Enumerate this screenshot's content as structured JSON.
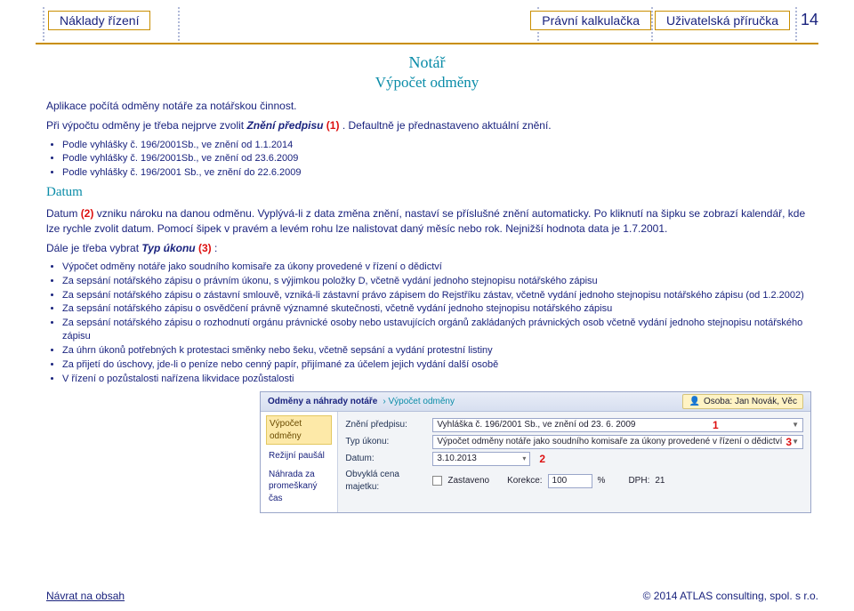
{
  "header": {
    "left": "Náklady řízení",
    "mid": "Právní kalkulačka",
    "right": "Uživatelská příručka",
    "page": "14"
  },
  "title": "Notář",
  "subtitle": "Výpočet odměny",
  "p1a": "Aplikace počítá odměny notáře za notářskou činnost.",
  "p2a": "Při výpočtu odměny je třeba nejprve zvolit ",
  "p2b": "Znění předpisu ",
  "p2c": "(1)",
  "p2d": ". Defaultně je přednastaveno aktuální znění.",
  "vyhl": [
    "Podle vyhlášky č. 196/2001Sb., ve znění od 1.1.2014",
    "Podle vyhlášky č. 196/2001Sb., ve znění od 23.6.2009",
    "Podle vyhlášky č. 196/2001 Sb., ve znění do 22.6.2009"
  ],
  "datum_head": "Datum",
  "datum_a": "Datum ",
  "datum_b": "(2)",
  "datum_c": " vzniku nároku na danou odměnu. Vyplývá-li z data změna znění, nastaví se příslušné znění automaticky. Po kliknutí na šipku se zobrazí kalendář, kde lze rychle zvolit datum. Pomocí šipek v pravém a levém rohu lze nalistovat daný měsíc nebo rok. Nejnižší hodnota data je 1.7.2001.",
  "typ_a": "Dále je třeba vybrat ",
  "typ_b": "Typ úkonu ",
  "typ_c": "(3)",
  "typ_d": ":",
  "ukony": [
    "Výpočet odměny notáře jako soudního komisaře za úkony provedené v řízení o dědictví",
    "Za sepsání notářského zápisu o právním úkonu, s výjimkou položky D, včetně vydání jednoho stejnopisu notářského zápisu",
    "Za sepsání notářského zápisu o zástavní smlouvě, vzniká-li zástavní právo zápisem do Rejstříku zástav, včetně vydání jednoho stejnopisu notářského zápisu (od 1.2.2002)",
    "Za sepsání notářského zápisu o osvědčení právně významné skutečnosti, včetně vydání jednoho stejnopisu notářského zápisu",
    "Za sepsání notářského zápisu o rozhodnutí orgánu právnické osoby nebo ustavujících orgánů zakládaných právnických osob včetně vydání jednoho stejnopisu notářského zápisu",
    "Za úhrn úkonů potřebných k protestaci směnky nebo šeku, včetně sepsání a vydání protestní listiny",
    "Za přijetí do úschovy, jde-li o peníze nebo cenný papír, přijímané za účelem jejich vydání další osobě",
    "V řízení o pozůstalosti nařízena likvidace pozůstalosti"
  ],
  "footer": {
    "back": "Návrat na obsah",
    "copy": "© 2014 ATLAS consulting, spol. s r.o."
  },
  "app": {
    "title_a": "Odměny a náhrady notáře",
    "title_b": "› Výpočet odměny",
    "person": "Osoba: Jan Novák, Věc",
    "side": {
      "sel": "Výpočet odměny",
      "i1": "Režijní paušál",
      "i2": "Náhrada za promeškaný čas"
    },
    "labels": {
      "zneni": "Znění předpisu:",
      "typ": "Typ úkonu:",
      "datum": "Datum:",
      "obvykla": "Obvyklá cena majetku:",
      "zastaveno": "Zastaveno",
      "korekce": "Korekce:",
      "pct": "%",
      "dph": "DPH:",
      "dphval": "21"
    },
    "values": {
      "zneni": "Vyhláška č. 196/2001 Sb., ve znění od 23. 6. 2009",
      "typ": "Výpočet odměny notáře jako soudního komisaře za úkony provedené v řízení o dědictví",
      "datum": "3.10.2013",
      "korekce": "100"
    },
    "markers": {
      "m1": "1",
      "m2": "2",
      "m3": "3"
    }
  }
}
